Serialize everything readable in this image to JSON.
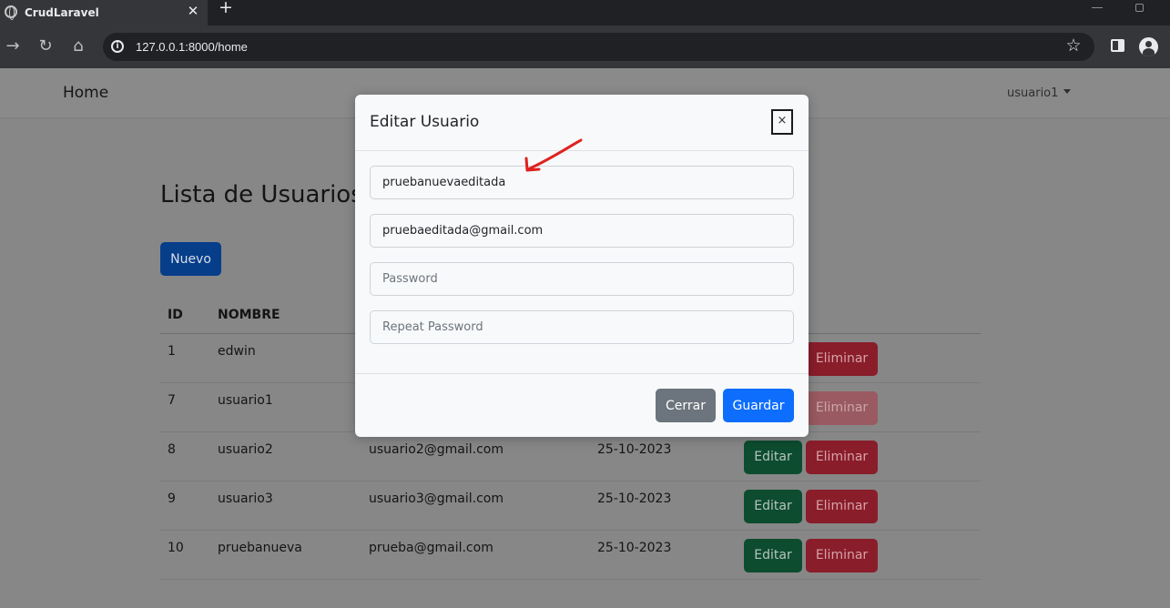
{
  "browser": {
    "tab_title": "CrudLaravel",
    "tab_close": "✕",
    "new_tab": "+",
    "url": "127.0.0.1:8000/home"
  },
  "navbar": {
    "brand": "Home",
    "user": "usuario1"
  },
  "page": {
    "title": "Lista de Usuarios",
    "new_button": "Nuevo"
  },
  "table": {
    "headers": [
      "ID",
      "NOMBRE",
      "",
      "",
      ""
    ],
    "rows": [
      {
        "id": "1",
        "nombre": "edwin",
        "email": "",
        "fecha": ""
      },
      {
        "id": "7",
        "nombre": "usuario1",
        "email": "",
        "fecha": ""
      },
      {
        "id": "8",
        "nombre": "usuario2",
        "email": "usuario2@gmail.com",
        "fecha": "25-10-2023"
      },
      {
        "id": "9",
        "nombre": "usuario3",
        "email": "usuario3@gmail.com",
        "fecha": "25-10-2023"
      },
      {
        "id": "10",
        "nombre": "pruebanueva",
        "email": "prueba@gmail.com",
        "fecha": "25-10-2023"
      }
    ],
    "edit_label": "Editar",
    "delete_label": "Eliminar"
  },
  "modal": {
    "title": "Editar Usuario",
    "close_symbol": "×",
    "name_value": "pruebanuevaeditada",
    "email_value": "pruebaeditada@gmail.com",
    "password_placeholder": "Password",
    "repeat_password_placeholder": "Repeat Password",
    "cancel_label": "Cerrar",
    "save_label": "Guardar"
  },
  "colors": {
    "primary": "#0d6efd",
    "secondary": "#6c757d",
    "annotation_arrow": "#e0211f"
  }
}
